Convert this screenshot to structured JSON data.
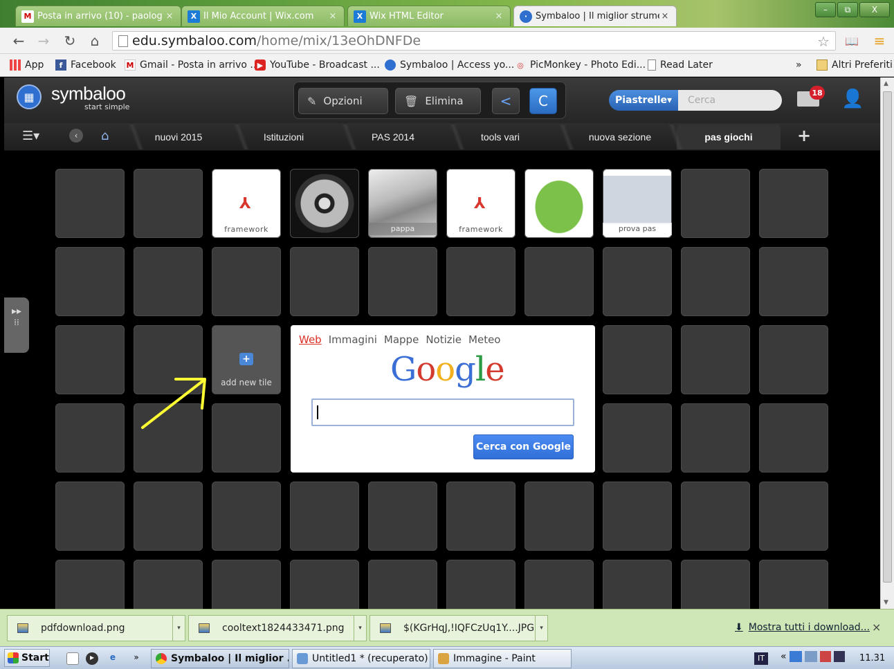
{
  "browser": {
    "tabs": [
      {
        "title": "Posta in arrivo (10) - paolog",
        "icon": "gmail-icon",
        "active": false
      },
      {
        "title": "Il Mio Account | Wix.com",
        "icon": "wix-icon",
        "active": false
      },
      {
        "title": "Wix HTML Editor",
        "icon": "wix-icon",
        "active": false
      },
      {
        "title": "Symbaloo | Il miglior strumen",
        "icon": "symbaloo-icon",
        "active": true
      }
    ],
    "window_buttons": {
      "minimize": "–",
      "restore": "⧉",
      "close": "X"
    },
    "url_host": "edu.symbaloo.com",
    "url_path": "/home/mix/13eOhDNFDe",
    "bookmarks": [
      {
        "label": "App",
        "icon": "apps-grid-icon"
      },
      {
        "label": "Facebook",
        "icon": "facebook-icon"
      },
      {
        "label": "Gmail - Posta in arrivo ...",
        "icon": "gmail-icon"
      },
      {
        "label": "YouTube - Broadcast ...",
        "icon": "youtube-icon"
      },
      {
        "label": "Symbaloo | Access yo...",
        "icon": "symbaloo-icon"
      },
      {
        "label": "PicMonkey - Photo Edi...",
        "icon": "picmonkey-icon"
      },
      {
        "label": "Read Later",
        "icon": "document-icon"
      }
    ],
    "bookmarks_overflow": "»",
    "other_bookmarks": "Altri Preferiti"
  },
  "symbaloo": {
    "logo_text": "symbaloo",
    "logo_sub": "start simple",
    "tools": {
      "options": "Opzioni",
      "delete": "Elimina"
    },
    "tiles_toggle": "Piastrelle▾",
    "search_placeholder": "Cerca",
    "mail_badge": "18",
    "tabs": [
      "nuovi 2015",
      "Istituzioni",
      "PAS 2014",
      "tools vari",
      "nuova sezione",
      "pas giochi"
    ],
    "add_tab": "+",
    "tiles": {
      "t1": "framework",
      "t2": "",
      "t3": "pappa",
      "t4": "framework",
      "t5": "",
      "t6": "prova pas"
    },
    "add_tile_label": "add new tile",
    "add_tile_plus": "+"
  },
  "google": {
    "links": [
      "Web",
      "Immagini",
      "Mappe",
      "Notizie",
      "Meteo"
    ],
    "logo": [
      "G",
      "o",
      "o",
      "g",
      "l",
      "e"
    ],
    "logo_colors": [
      "#3b6fd6",
      "#d43b2f",
      "#f2b01e",
      "#3b6fd6",
      "#2a9a43",
      "#d43b2f"
    ],
    "button": "Cerca con Google"
  },
  "downloads": {
    "items": [
      "pdfdownload.png",
      "cooltext1824433471.png",
      "$(KGrHqJ,!IQFCzUq1Y....JPG"
    ],
    "show_all": "Mostra tutti i download...",
    "close": "×"
  },
  "taskbar": {
    "start": "Start",
    "quicklaunch_more": "»",
    "tasks": [
      "Symbaloo | Il miglior ...",
      "Untitled1 * (recuperato) ...",
      "Immagine - Paint"
    ],
    "language": "IT",
    "tray_prefix": "«",
    "clock": "11.31"
  },
  "colors": {
    "accent_blue": "#2f6fd0",
    "badge_red": "#d5202c",
    "google_button": "#3b7de8"
  }
}
